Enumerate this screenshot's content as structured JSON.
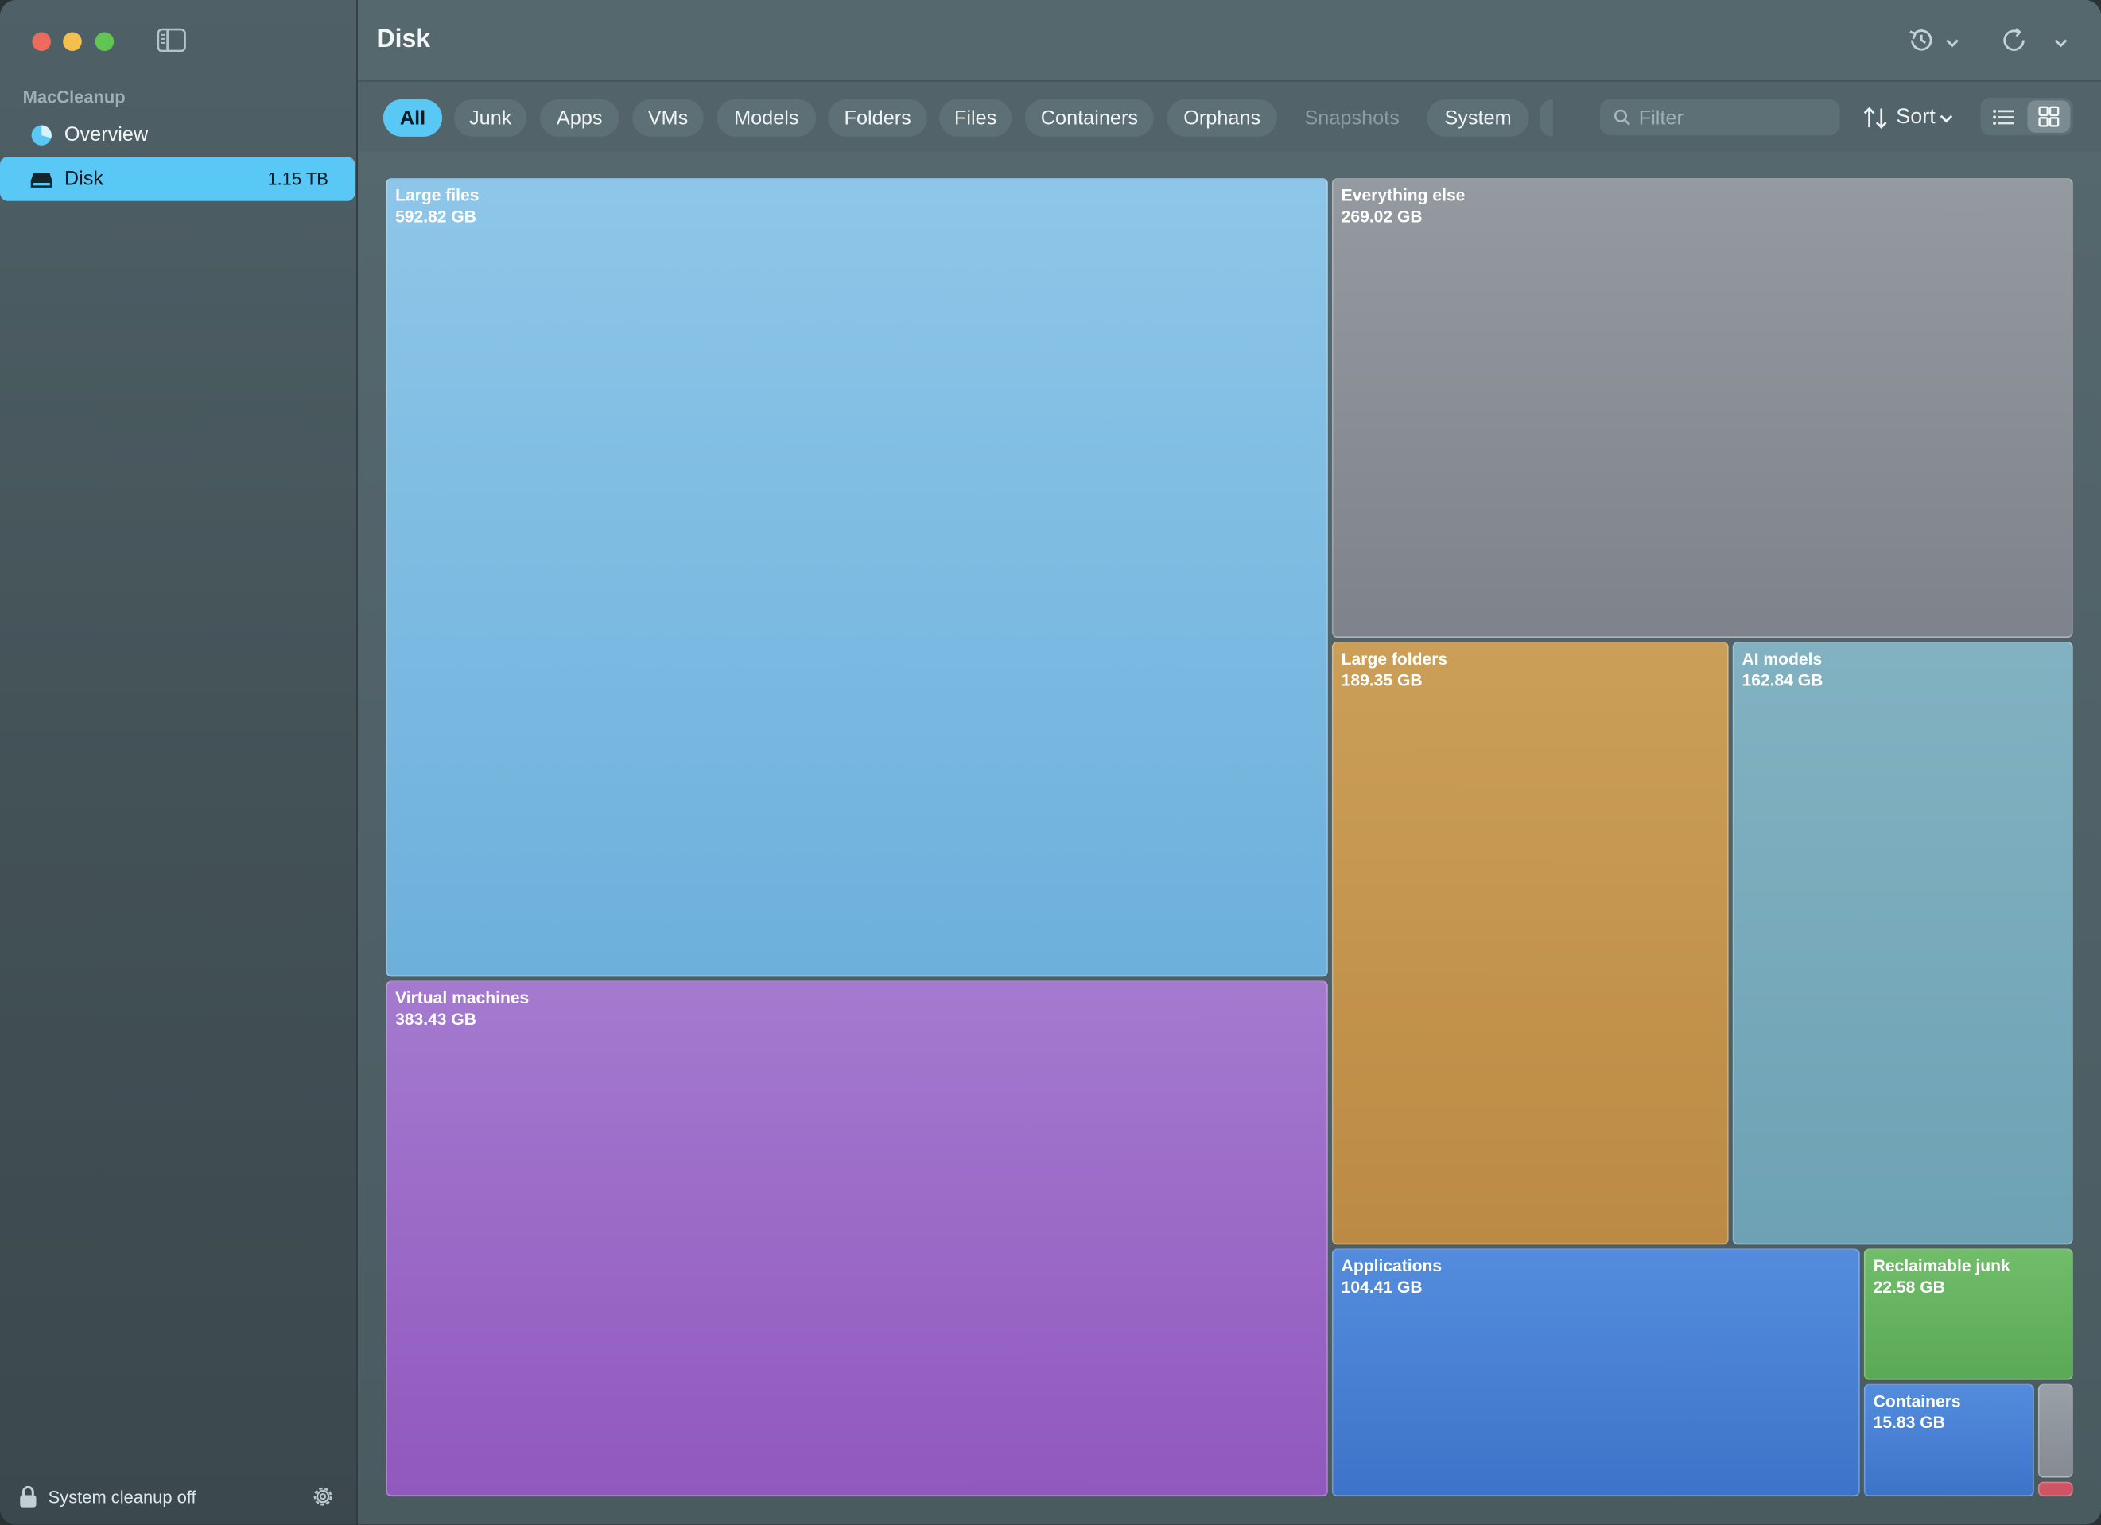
{
  "app": {
    "name": "MacCleanup"
  },
  "sidebar": {
    "items": [
      {
        "label": "Overview",
        "icon": "pie-chart-icon"
      },
      {
        "label": "Disk",
        "icon": "drive-icon",
        "count": "1.15 TB"
      }
    ],
    "footer": {
      "label": "System cleanup off",
      "icon": "lock-icon"
    }
  },
  "header": {
    "title": "Disk"
  },
  "filters": {
    "chips": [
      "All",
      "Junk",
      "Apps",
      "VMs",
      "Models",
      "Folders",
      "Files",
      "Containers",
      "Orphans",
      "Snapshots",
      "System"
    ],
    "active": "All",
    "disabled": [
      "Snapshots"
    ],
    "search_placeholder": "Filter",
    "sort_label": "Sort"
  },
  "colors": {
    "accent": "#5ac8f5",
    "large_files": "#7ab9e2",
    "everything_else": "#8a8f96",
    "large_folders": "#c79a52",
    "ai_models": "#76a8b9",
    "virtual_machines": "#9765c6",
    "applications": "#4a80d6",
    "reclaimable_junk": "#65b460",
    "containers": "#4a80d6"
  },
  "treemap": {
    "tiles": [
      {
        "name": "Large files",
        "size": "592.82 GB",
        "value_gb": 592.82
      },
      {
        "name": "Virtual machines",
        "size": "383.43 GB",
        "value_gb": 383.43
      },
      {
        "name": "Everything else",
        "size": "269.02 GB",
        "value_gb": 269.02
      },
      {
        "name": "Large folders",
        "size": "189.35 GB",
        "value_gb": 189.35
      },
      {
        "name": "AI models",
        "size": "162.84 GB",
        "value_gb": 162.84
      },
      {
        "name": "Applications",
        "size": "104.41 GB",
        "value_gb": 104.41
      },
      {
        "name": "Reclaimable junk",
        "size": "22.58 GB",
        "value_gb": 22.58
      },
      {
        "name": "Containers",
        "size": "15.83 GB",
        "value_gb": 15.83
      }
    ]
  }
}
